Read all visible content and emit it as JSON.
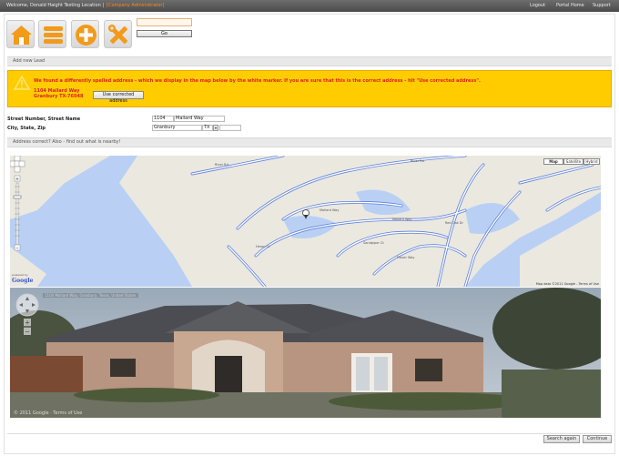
{
  "header": {
    "welcome": "Welcome, Donald Haight Testing Location |",
    "role": "[Company Administrator]",
    "nav": [
      "Logout",
      "Portal Home",
      "Support"
    ]
  },
  "toolbar": {
    "icons": [
      "home-icon",
      "list-icon",
      "add-icon",
      "tools-icon"
    ],
    "search_value": "",
    "go_label": "Go"
  },
  "section_add_lead": "Add new Lead",
  "warning": {
    "message": "We found a differently spelled address - which we display in the map below by the white marker. If you are sure that this is the correct address - hit \"Use corrected address\".",
    "address_line1": "1104 Mallard Way",
    "address_line2": "Granbury TX-76048",
    "button": "Use corrected address"
  },
  "form": {
    "street_label": "Street Number, Street Name",
    "city_label": "City, State, Zip",
    "street_number": "1104",
    "street_name": "Mallard Way",
    "city": "Granbury",
    "state": "TX",
    "zip": ""
  },
  "section_address_correct": "Address correct? Also - find out what is nearby!",
  "map": {
    "types": [
      "Map",
      "Satellite",
      "Hybrid"
    ],
    "active_type": "Map",
    "logo": "Google",
    "powered_by": "powered by",
    "attribution": "Map data ©2011 Google - Terms of Use",
    "road_labels": [
      "River Rd",
      "River Rd",
      "Mallard Way",
      "Mallard Way",
      "Sandpiper Ct",
      "Plover Way",
      "Heron Ct",
      "Red Oak Dr"
    ]
  },
  "streetview": {
    "address_overlay": "1104 Mallard Way, Granbury, Texas, United States",
    "copyright": "© 2011 Google · Terms of Use"
  },
  "footer": {
    "search_again": "Search again",
    "continue": "Continue"
  }
}
